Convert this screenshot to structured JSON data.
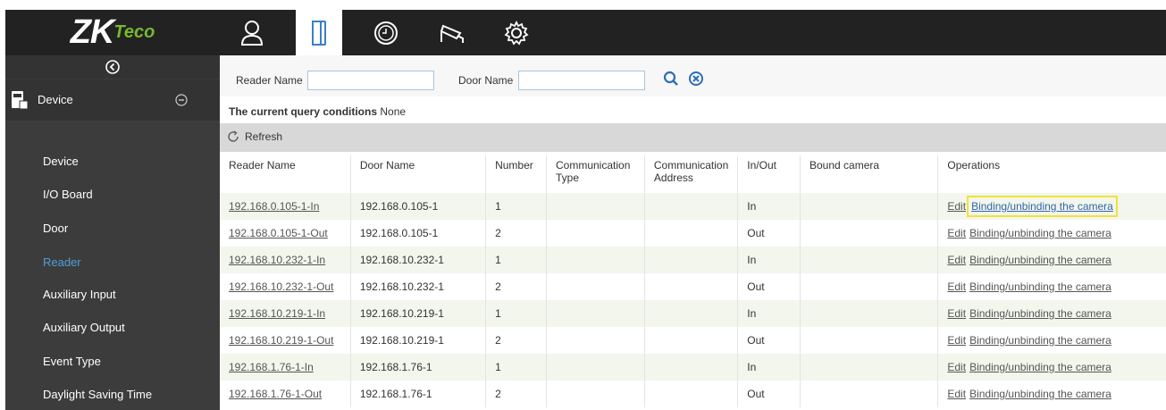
{
  "brand": {
    "logo_main": "ZK",
    "logo_sub": "Teco"
  },
  "nav_icons": [
    "user-icon",
    "door-icon",
    "clock-icon",
    "camera-icon",
    "gear-icon"
  ],
  "sidebar": {
    "group_label": "Device",
    "items": [
      "Device",
      "I/O Board",
      "Door",
      "Reader",
      "Auxiliary Input",
      "Auxiliary Output",
      "Event Type",
      "Daylight Saving Time"
    ],
    "active": "Reader"
  },
  "search": {
    "reader_label": "Reader Name",
    "door_label": "Door Name",
    "reader_value": "",
    "door_value": ""
  },
  "query": {
    "label": "The current query conditions",
    "value": "None"
  },
  "toolbar": {
    "refresh_label": "Refresh"
  },
  "table": {
    "headers": [
      "Reader Name",
      "Door Name",
      "Number",
      "Communication Type",
      "Communication Address",
      "In/Out",
      "Bound camera",
      "Operations"
    ],
    "rows": [
      {
        "reader": "192.168.0.105-1-In",
        "door": "192.168.0.105-1",
        "number": "1",
        "inout": "In"
      },
      {
        "reader": "192.168.0.105-1-Out",
        "door": "192.168.0.105-1",
        "number": "2",
        "inout": "Out"
      },
      {
        "reader": "192.168.10.232-1-In",
        "door": "192.168.10.232-1",
        "number": "1",
        "inout": "In"
      },
      {
        "reader": "192.168.10.232-1-Out",
        "door": "192.168.10.232-1",
        "number": "2",
        "inout": "Out"
      },
      {
        "reader": "192.168.10.219-1-In",
        "door": "192.168.10.219-1",
        "number": "1",
        "inout": "In"
      },
      {
        "reader": "192.168.10.219-1-Out",
        "door": "192.168.10.219-1",
        "number": "2",
        "inout": "Out"
      },
      {
        "reader": "192.168.1.76-1-In",
        "door": "192.168.1.76-1",
        "number": "1",
        "inout": "In"
      },
      {
        "reader": "192.168.1.76-1-Out",
        "door": "192.168.1.76-1",
        "number": "2",
        "inout": "Out"
      }
    ],
    "edit_label": "Edit",
    "bind_label": "Binding/unbinding the camera"
  },
  "colors": {
    "accent": "#4d9fd9",
    "highlight": "#f0e23a",
    "sidebar": "#3c3c3c",
    "topbar": "#222222"
  }
}
